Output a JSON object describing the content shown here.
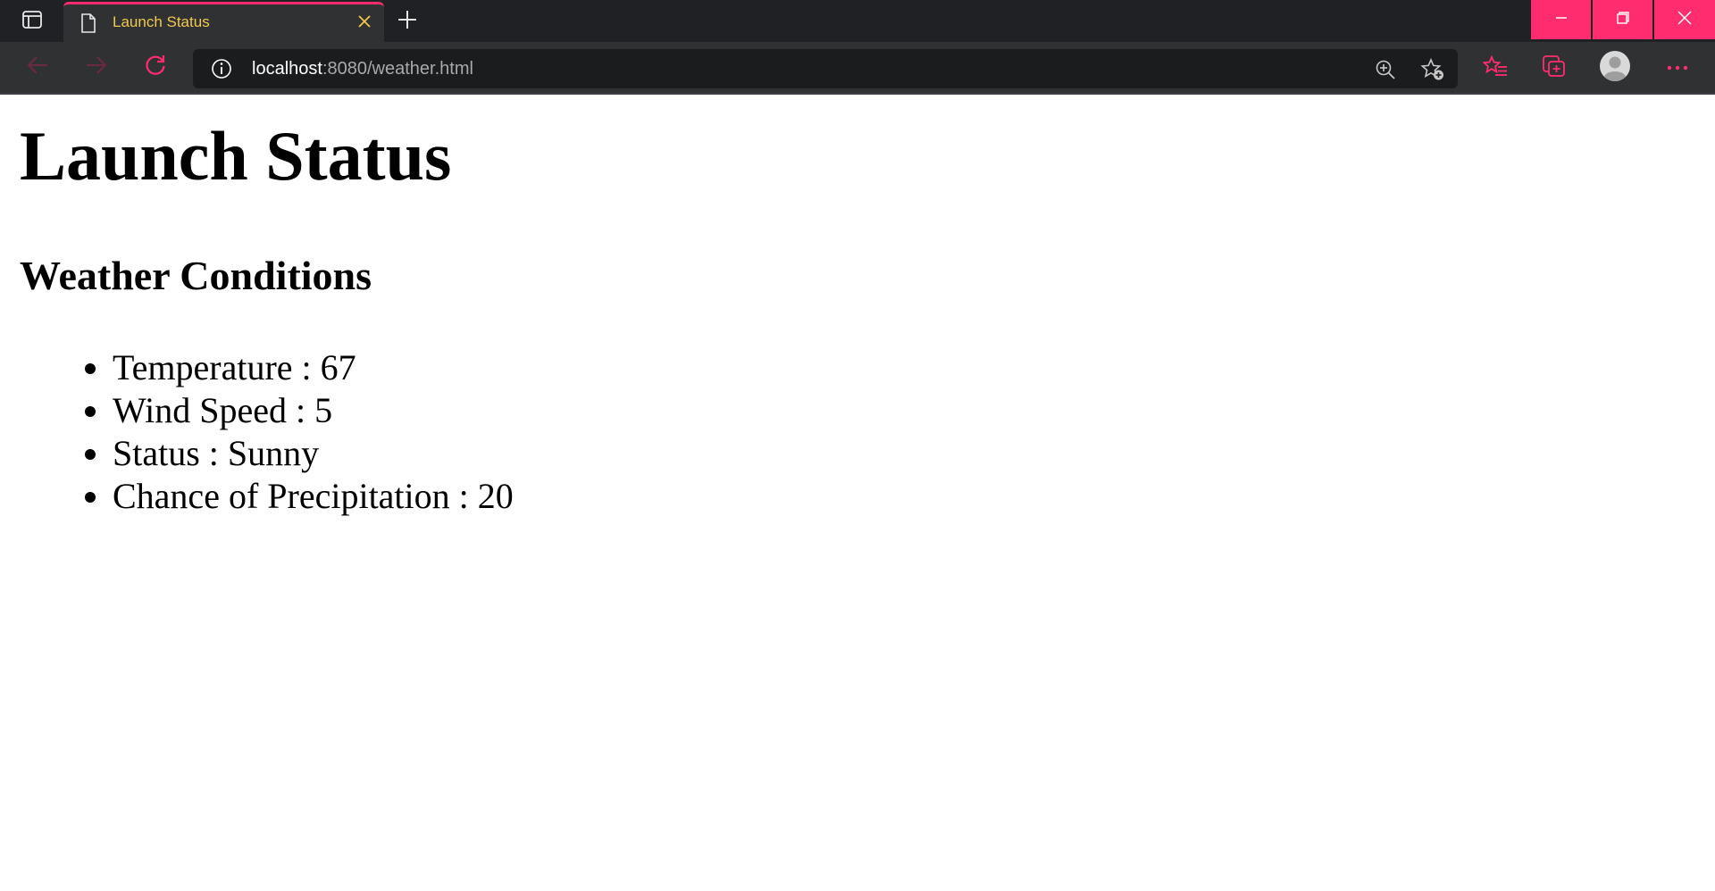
{
  "browser": {
    "tab": {
      "title": "Launch Status",
      "close_icon": "close-icon",
      "favicon": "page-icon"
    },
    "url": {
      "host": "localhost",
      "rest": ":8080/weather.html"
    },
    "colors": {
      "accent": "#ff2d6f",
      "tab_title": "#f2c94c",
      "chrome_bg": "#202124",
      "toolbar_bg": "#2f3133",
      "address_bg": "#1b1c1e"
    },
    "icons": {
      "tab_actions": "tab-actions-icon",
      "new_tab": "plus-icon",
      "minimize": "minimize-icon",
      "maximize": "restore-icon",
      "close": "close-icon",
      "back": "arrow-left-icon",
      "forward": "arrow-right-icon",
      "refresh": "refresh-icon",
      "site_info": "info-icon",
      "zoom": "zoom-in-icon",
      "add_favorite": "star-add-icon",
      "favorites": "favorites-icon",
      "collections": "collections-icon",
      "profile": "avatar-icon",
      "more": "more-icon"
    }
  },
  "page": {
    "title": "Launch Status",
    "section_title": "Weather Conditions",
    "conditions": [
      "Temperature : 67",
      "Wind Speed : 5",
      "Status : Sunny",
      "Chance of Precipitation : 20"
    ]
  }
}
